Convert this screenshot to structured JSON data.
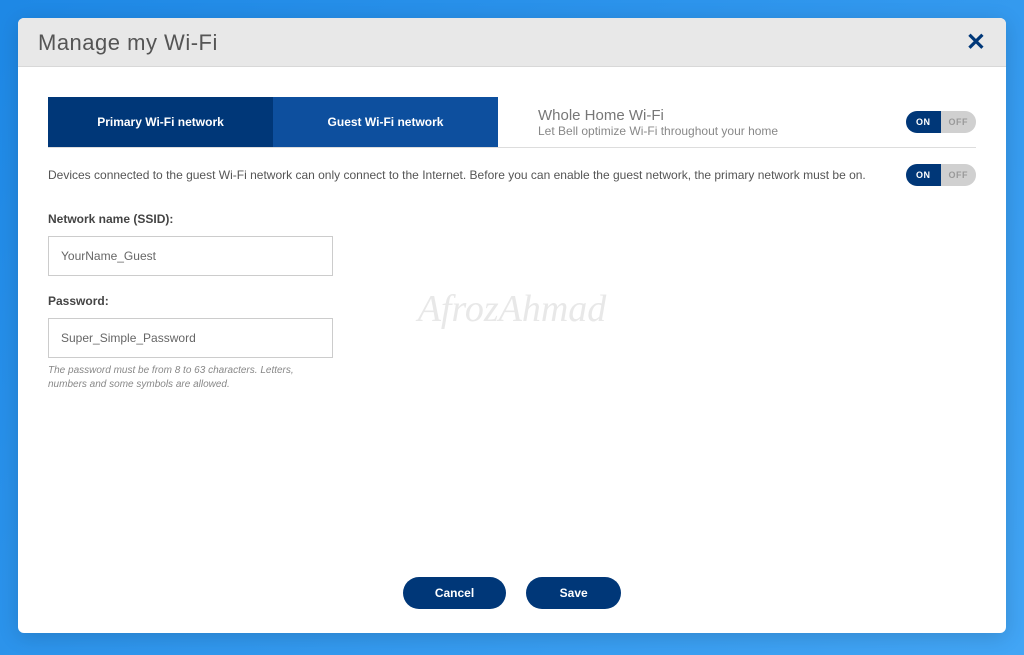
{
  "modal": {
    "title": "Manage my Wi-Fi"
  },
  "tabs": {
    "primary": "Primary Wi-Fi network",
    "guest": "Guest Wi-Fi network"
  },
  "wholeHome": {
    "title": "Whole Home Wi-Fi",
    "subtitle": "Let Bell optimize Wi-Fi throughout your home"
  },
  "toggle": {
    "on": "ON",
    "off": "OFF"
  },
  "guestInfo": {
    "description": "Devices connected to the guest Wi-Fi network can only connect to the Internet. Before you can enable the guest network, the primary network must be on."
  },
  "form": {
    "ssidLabel": "Network name (SSID):",
    "ssidValue": "YourName_Guest",
    "passwordLabel": "Password:",
    "passwordValue": "Super_Simple_Password",
    "passwordHint": "The password must be from 8 to 63 characters. Letters, numbers and some symbols are allowed."
  },
  "buttons": {
    "cancel": "Cancel",
    "save": "Save"
  },
  "watermark": "AfrozAhmad"
}
